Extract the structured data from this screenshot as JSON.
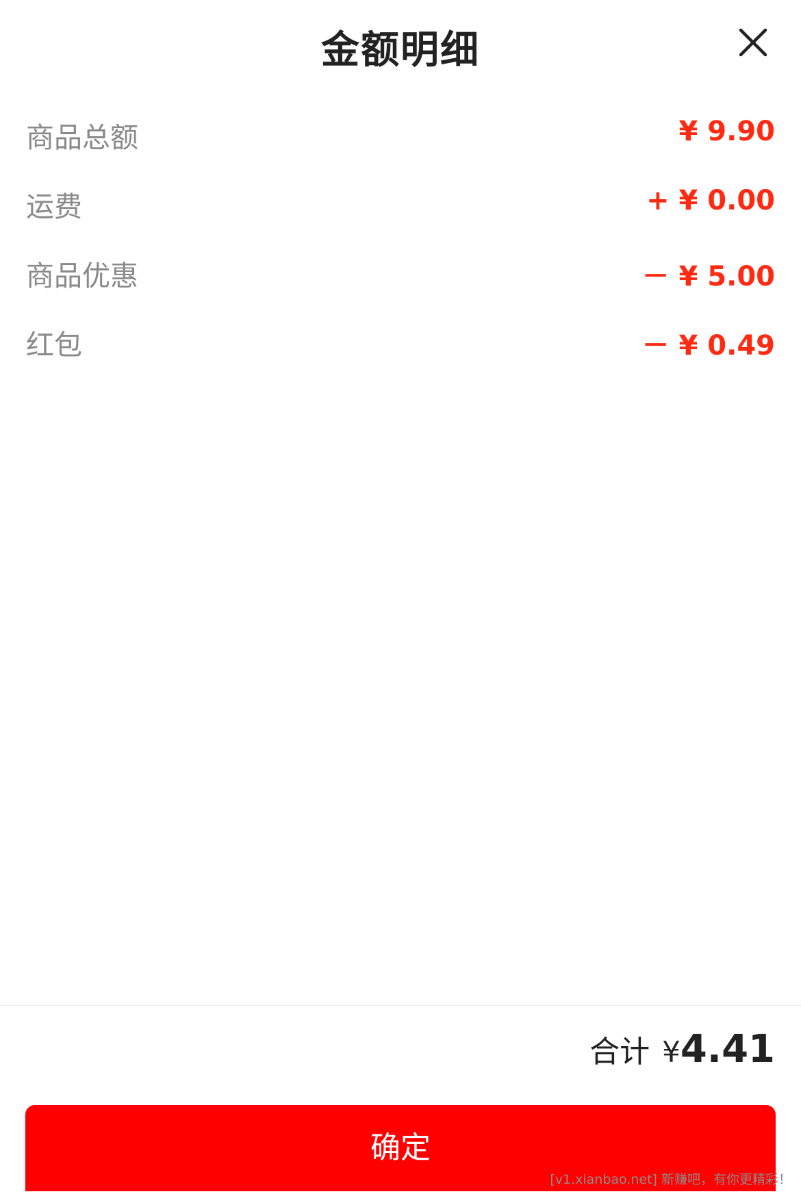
{
  "header": {
    "title": "金额明细",
    "close_icon": "close-icon"
  },
  "rows": [
    {
      "label": "商品总额",
      "value": "¥ 9.90"
    },
    {
      "label": "运费",
      "value": "+ ¥ 0.00"
    },
    {
      "label": "商品优惠",
      "value": "－ ¥ 5.00"
    },
    {
      "label": "红包",
      "value": "－ ¥ 0.49"
    }
  ],
  "footer": {
    "total_label": "合计",
    "total_currency": "¥",
    "total_value": "4.41",
    "confirm_label": "确定"
  },
  "watermark": "[v1.xianbao.net] 新赚吧，有你更精彩！",
  "colors": {
    "accent": "#ff2a12",
    "button": "#ff0000",
    "label": "#8a8a8a",
    "title": "#222222"
  }
}
